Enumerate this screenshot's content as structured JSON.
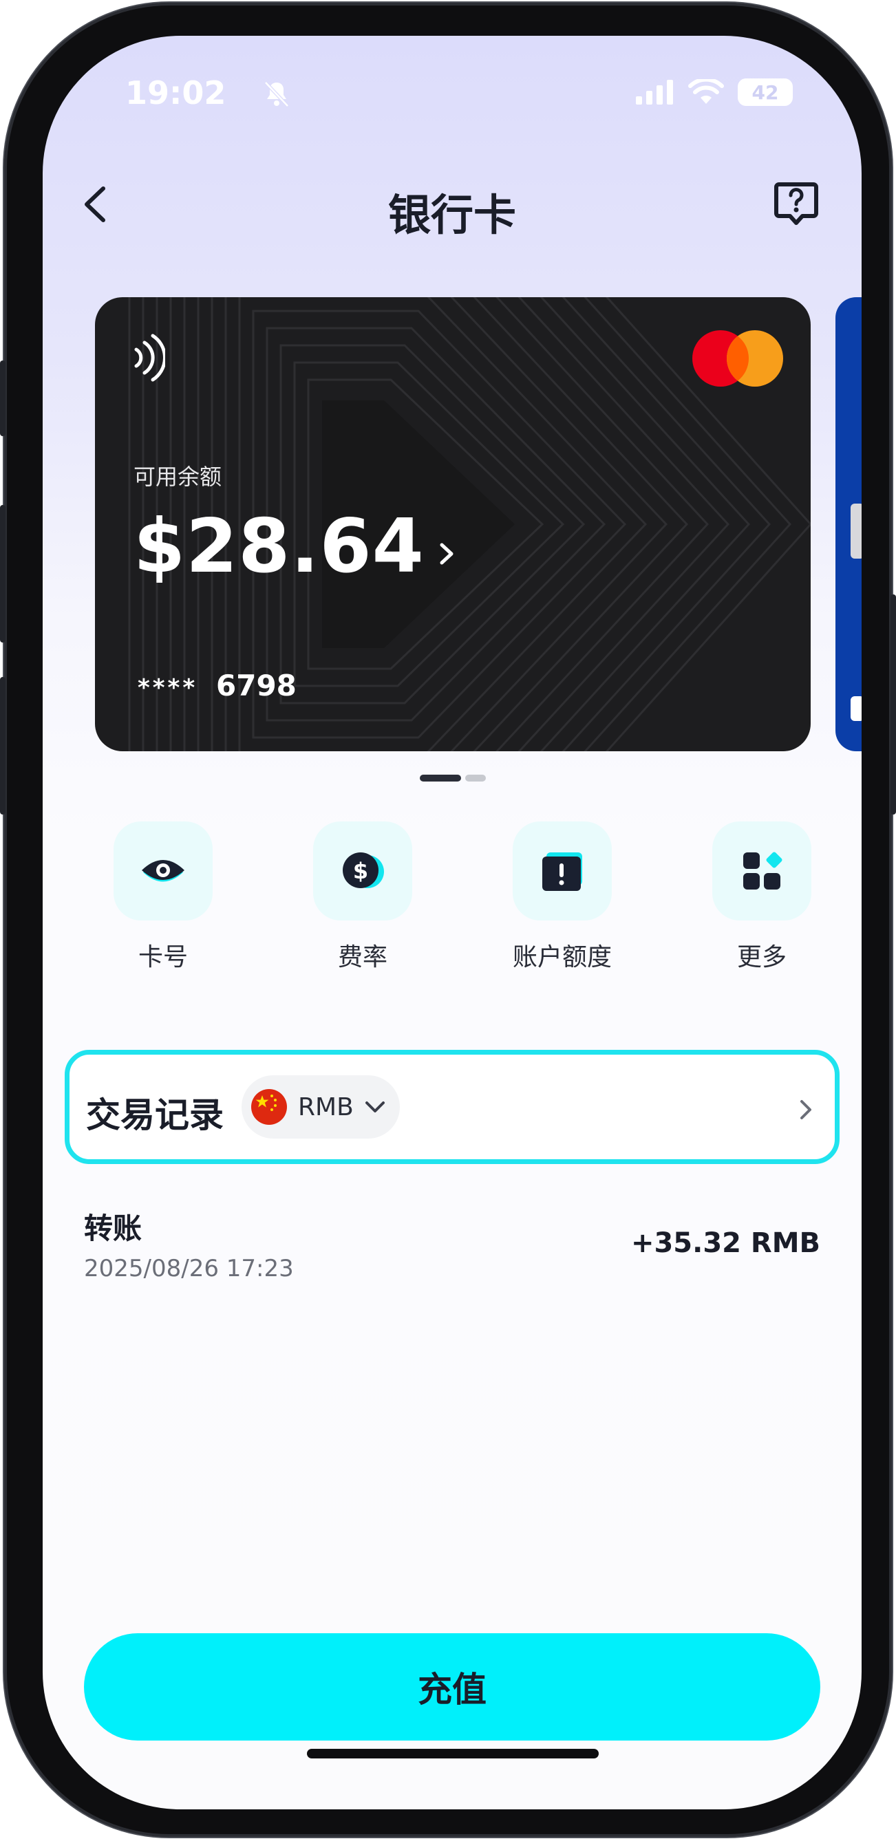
{
  "status_bar": {
    "time": "19:02",
    "battery": "42",
    "icons": [
      "bell-muted-icon",
      "cellular-icon",
      "wifi-icon",
      "battery-icon"
    ]
  },
  "nav": {
    "title": "银行卡",
    "back_icon": "chevron-left-icon",
    "help_icon": "help-bubble-icon"
  },
  "card": {
    "label": "可用余额",
    "balance": "$28.64",
    "masked": "****",
    "last_digits": "6798",
    "brand": "mastercard-logo",
    "background": "#1d1d1f"
  },
  "carousel": {
    "active_index": 0,
    "count": 2
  },
  "actions": [
    {
      "label": "卡号",
      "icon": "eye-icon"
    },
    {
      "label": "费率",
      "icon": "dollar-coin-icon"
    },
    {
      "label": "账户额度",
      "icon": "alert-card-icon"
    },
    {
      "label": "更多",
      "icon": "grid-icon"
    }
  ],
  "transactions": {
    "title": "交易记录",
    "currency": "RMB",
    "currency_flag": "china-flag-icon",
    "items": [
      {
        "type": "转账",
        "date": "2025/08/26 17:23",
        "amount": "+35.32 RMB"
      }
    ]
  },
  "recharge_label": "充值",
  "colors": {
    "accent": "#00f0fb",
    "highlight_border": "#1fe3ee",
    "tile_bg": "#e9fbfc",
    "text_primary": "#1a1d29"
  }
}
